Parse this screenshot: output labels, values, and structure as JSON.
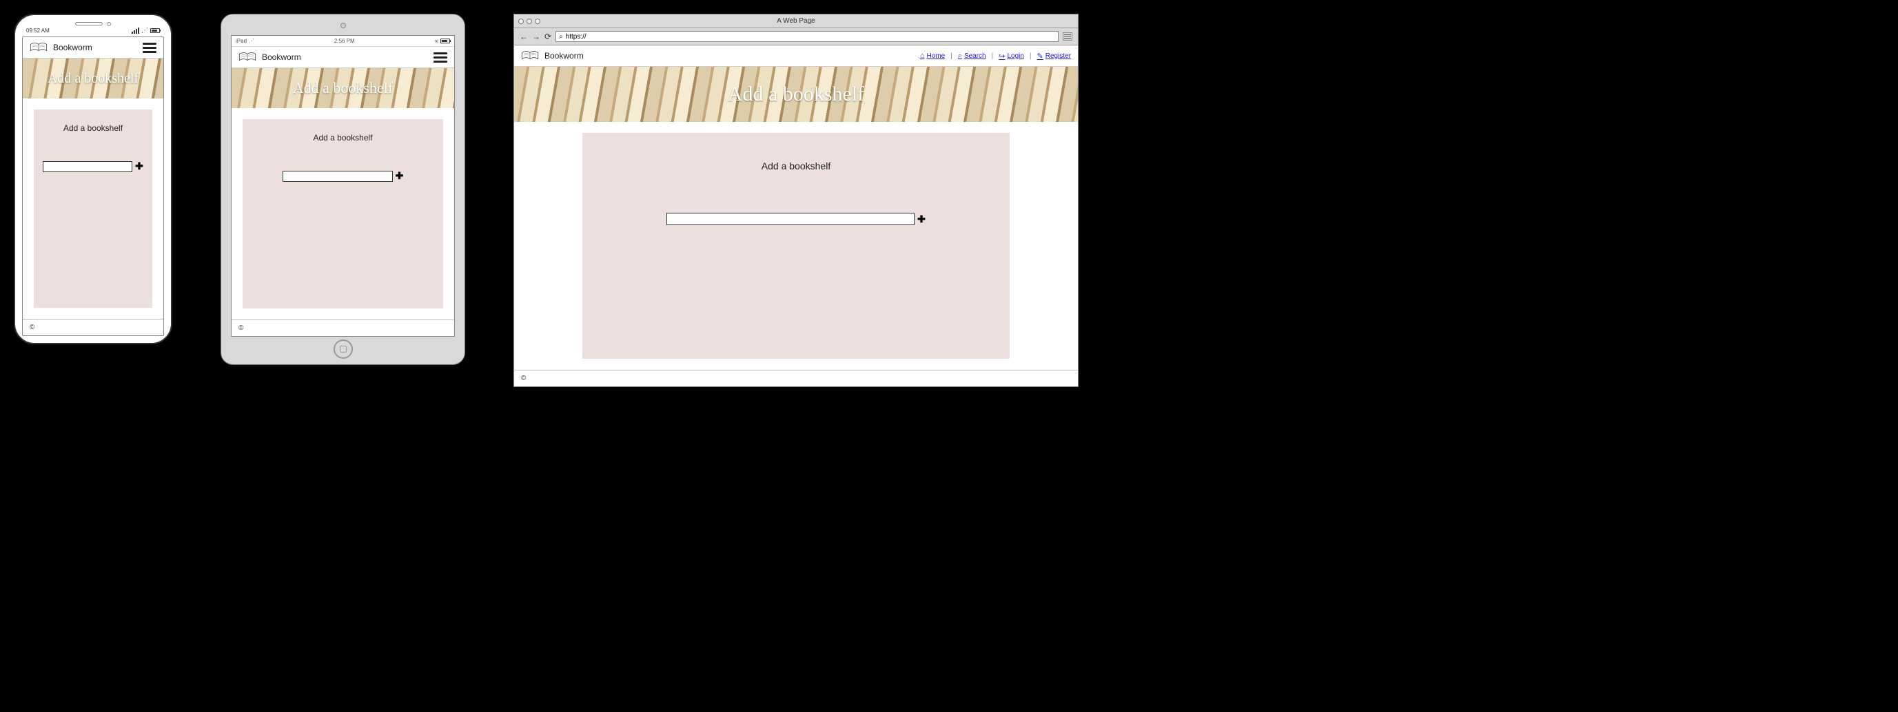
{
  "brand": {
    "name": "Bookworm"
  },
  "hero": {
    "title": "Add a bookshelf"
  },
  "card": {
    "title": "Add a bookshelf"
  },
  "footer": {
    "copyright": "©"
  },
  "phone": {
    "time": "09:52 AM"
  },
  "tablet": {
    "carrier": "iPad",
    "time": "2:56 PM",
    "wifi_icon": "᯾"
  },
  "browser": {
    "window_title": "A Web Page",
    "url_prefix": "https://",
    "nav": {
      "home": "Home",
      "search": "Search",
      "login": "Login",
      "register": "Register"
    }
  },
  "icons": {
    "home": "⌂",
    "search": "⌕",
    "login": "↪",
    "register": "✎",
    "plus": "✚",
    "wifi": "⋰",
    "reload": "⟳",
    "back": "←",
    "forward": "→"
  }
}
